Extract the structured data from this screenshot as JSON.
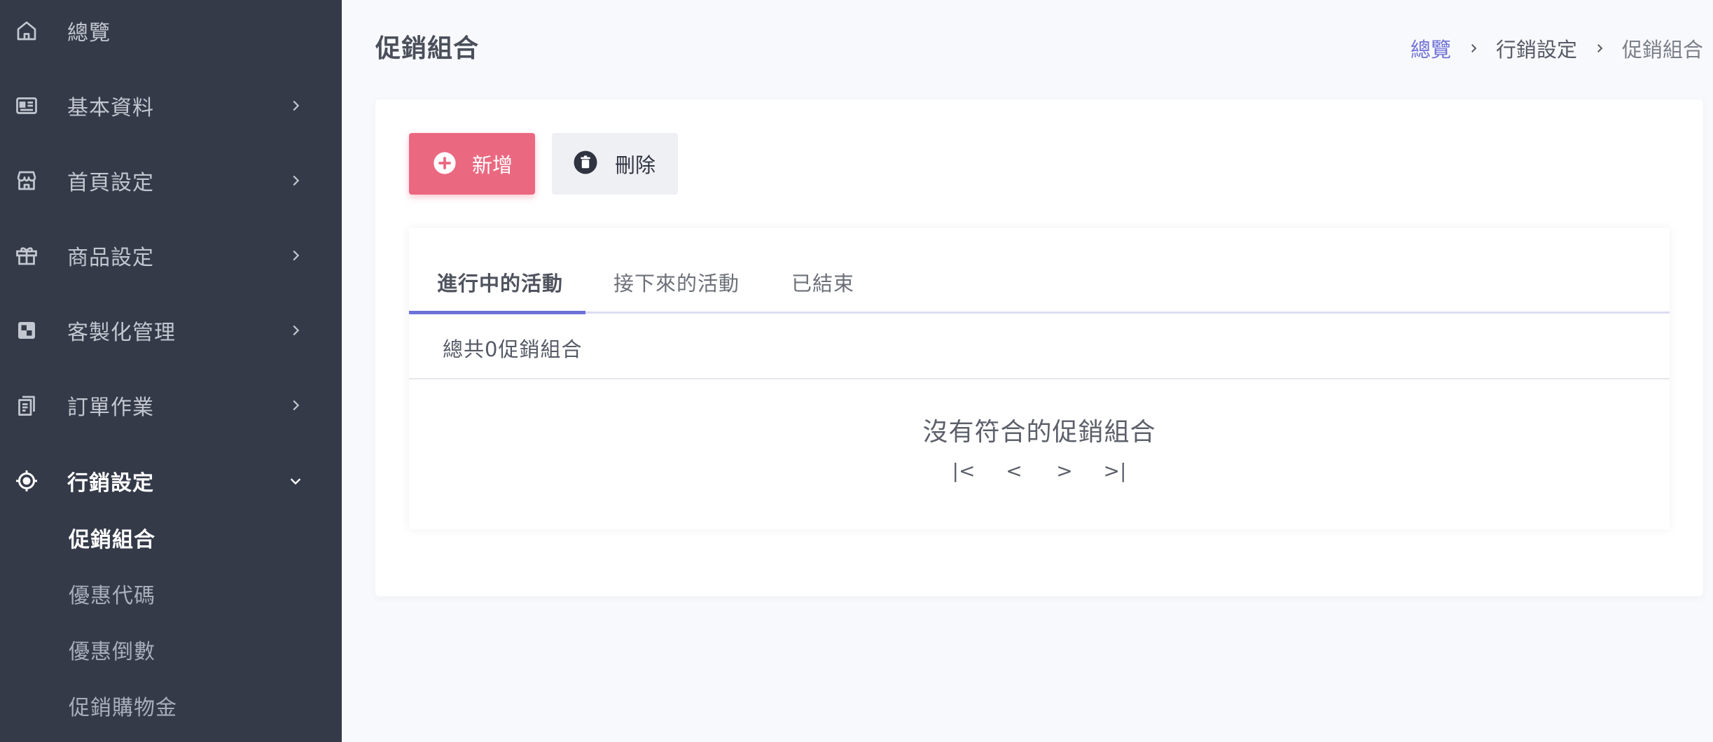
{
  "sidebar": {
    "items": [
      {
        "label": "總覽",
        "icon": "home-icon"
      },
      {
        "label": "基本資料",
        "icon": "profile-card-icon"
      },
      {
        "label": "首頁設定",
        "icon": "storefront-icon"
      },
      {
        "label": "商品設定",
        "icon": "gift-icon"
      },
      {
        "label": "客製化管理",
        "icon": "customize-icon"
      },
      {
        "label": "訂單作業",
        "icon": "clipboard-icon"
      },
      {
        "label": "行銷設定",
        "icon": "target-icon"
      }
    ],
    "sub_items": [
      {
        "label": "促銷組合"
      },
      {
        "label": "優惠代碼"
      },
      {
        "label": "優惠倒數"
      },
      {
        "label": "促銷購物金"
      }
    ]
  },
  "header": {
    "title": "促銷組合",
    "breadcrumb": [
      "總覽",
      "行銷設定",
      "促銷組合"
    ]
  },
  "toolbar": {
    "add_label": "新增",
    "delete_label": "刪除"
  },
  "tabs": [
    {
      "label": "進行中的活動"
    },
    {
      "label": "接下來的活動"
    },
    {
      "label": "已結束"
    }
  ],
  "list": {
    "summary": "總共0促銷組合",
    "empty_message": "沒有符合的促銷組合"
  },
  "pagination": {
    "first": "|<",
    "prev": "<",
    "next": ">",
    "last": ">|"
  },
  "colors": {
    "sidebar_bg": "#343a48",
    "accent": "#6e72d8",
    "add_button": "#ea6880",
    "delete_button": "#eef0f4"
  }
}
